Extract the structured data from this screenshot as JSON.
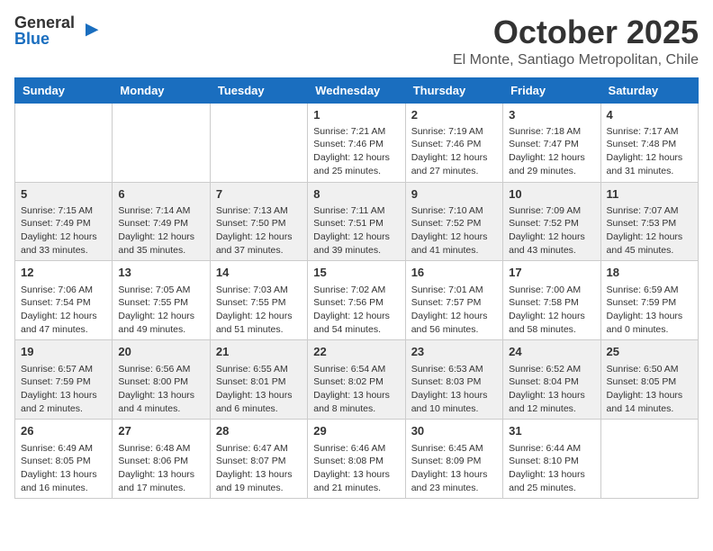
{
  "logo": {
    "general": "General",
    "blue": "Blue"
  },
  "title": "October 2025",
  "location": "El Monte, Santiago Metropolitan, Chile",
  "days": [
    "Sunday",
    "Monday",
    "Tuesday",
    "Wednesday",
    "Thursday",
    "Friday",
    "Saturday"
  ],
  "weeks": [
    [
      {
        "day": "",
        "info": ""
      },
      {
        "day": "",
        "info": ""
      },
      {
        "day": "",
        "info": ""
      },
      {
        "day": "1",
        "info": "Sunrise: 7:21 AM\nSunset: 7:46 PM\nDaylight: 12 hours\nand 25 minutes."
      },
      {
        "day": "2",
        "info": "Sunrise: 7:19 AM\nSunset: 7:46 PM\nDaylight: 12 hours\nand 27 minutes."
      },
      {
        "day": "3",
        "info": "Sunrise: 7:18 AM\nSunset: 7:47 PM\nDaylight: 12 hours\nand 29 minutes."
      },
      {
        "day": "4",
        "info": "Sunrise: 7:17 AM\nSunset: 7:48 PM\nDaylight: 12 hours\nand 31 minutes."
      }
    ],
    [
      {
        "day": "5",
        "info": "Sunrise: 7:15 AM\nSunset: 7:49 PM\nDaylight: 12 hours\nand 33 minutes."
      },
      {
        "day": "6",
        "info": "Sunrise: 7:14 AM\nSunset: 7:49 PM\nDaylight: 12 hours\nand 35 minutes."
      },
      {
        "day": "7",
        "info": "Sunrise: 7:13 AM\nSunset: 7:50 PM\nDaylight: 12 hours\nand 37 minutes."
      },
      {
        "day": "8",
        "info": "Sunrise: 7:11 AM\nSunset: 7:51 PM\nDaylight: 12 hours\nand 39 minutes."
      },
      {
        "day": "9",
        "info": "Sunrise: 7:10 AM\nSunset: 7:52 PM\nDaylight: 12 hours\nand 41 minutes."
      },
      {
        "day": "10",
        "info": "Sunrise: 7:09 AM\nSunset: 7:52 PM\nDaylight: 12 hours\nand 43 minutes."
      },
      {
        "day": "11",
        "info": "Sunrise: 7:07 AM\nSunset: 7:53 PM\nDaylight: 12 hours\nand 45 minutes."
      }
    ],
    [
      {
        "day": "12",
        "info": "Sunrise: 7:06 AM\nSunset: 7:54 PM\nDaylight: 12 hours\nand 47 minutes."
      },
      {
        "day": "13",
        "info": "Sunrise: 7:05 AM\nSunset: 7:55 PM\nDaylight: 12 hours\nand 49 minutes."
      },
      {
        "day": "14",
        "info": "Sunrise: 7:03 AM\nSunset: 7:55 PM\nDaylight: 12 hours\nand 51 minutes."
      },
      {
        "day": "15",
        "info": "Sunrise: 7:02 AM\nSunset: 7:56 PM\nDaylight: 12 hours\nand 54 minutes."
      },
      {
        "day": "16",
        "info": "Sunrise: 7:01 AM\nSunset: 7:57 PM\nDaylight: 12 hours\nand 56 minutes."
      },
      {
        "day": "17",
        "info": "Sunrise: 7:00 AM\nSunset: 7:58 PM\nDaylight: 12 hours\nand 58 minutes."
      },
      {
        "day": "18",
        "info": "Sunrise: 6:59 AM\nSunset: 7:59 PM\nDaylight: 13 hours\nand 0 minutes."
      }
    ],
    [
      {
        "day": "19",
        "info": "Sunrise: 6:57 AM\nSunset: 7:59 PM\nDaylight: 13 hours\nand 2 minutes."
      },
      {
        "day": "20",
        "info": "Sunrise: 6:56 AM\nSunset: 8:00 PM\nDaylight: 13 hours\nand 4 minutes."
      },
      {
        "day": "21",
        "info": "Sunrise: 6:55 AM\nSunset: 8:01 PM\nDaylight: 13 hours\nand 6 minutes."
      },
      {
        "day": "22",
        "info": "Sunrise: 6:54 AM\nSunset: 8:02 PM\nDaylight: 13 hours\nand 8 minutes."
      },
      {
        "day": "23",
        "info": "Sunrise: 6:53 AM\nSunset: 8:03 PM\nDaylight: 13 hours\nand 10 minutes."
      },
      {
        "day": "24",
        "info": "Sunrise: 6:52 AM\nSunset: 8:04 PM\nDaylight: 13 hours\nand 12 minutes."
      },
      {
        "day": "25",
        "info": "Sunrise: 6:50 AM\nSunset: 8:05 PM\nDaylight: 13 hours\nand 14 minutes."
      }
    ],
    [
      {
        "day": "26",
        "info": "Sunrise: 6:49 AM\nSunset: 8:05 PM\nDaylight: 13 hours\nand 16 minutes."
      },
      {
        "day": "27",
        "info": "Sunrise: 6:48 AM\nSunset: 8:06 PM\nDaylight: 13 hours\nand 17 minutes."
      },
      {
        "day": "28",
        "info": "Sunrise: 6:47 AM\nSunset: 8:07 PM\nDaylight: 13 hours\nand 19 minutes."
      },
      {
        "day": "29",
        "info": "Sunrise: 6:46 AM\nSunset: 8:08 PM\nDaylight: 13 hours\nand 21 minutes."
      },
      {
        "day": "30",
        "info": "Sunrise: 6:45 AM\nSunset: 8:09 PM\nDaylight: 13 hours\nand 23 minutes."
      },
      {
        "day": "31",
        "info": "Sunrise: 6:44 AM\nSunset: 8:10 PM\nDaylight: 13 hours\nand 25 minutes."
      },
      {
        "day": "",
        "info": ""
      }
    ]
  ]
}
